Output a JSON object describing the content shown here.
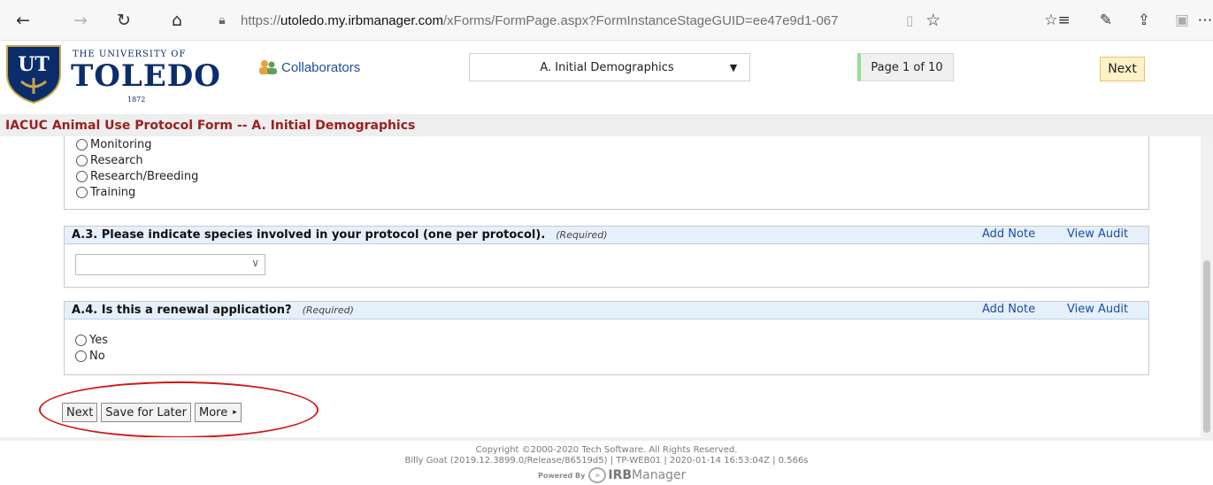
{
  "browser": {
    "url_prefix": "https://",
    "url_host": "utoledo.my.irbmanager.com",
    "url_path": "/xForms/FormPage.aspx?FormInstanceStageGUID=ee47e9d1-067",
    "icons": [
      "back-icon",
      "forward-icon",
      "refresh-icon",
      "home-icon",
      "lock-icon",
      "reading-view-icon",
      "favorite-star-icon",
      "favorites-list-icon",
      "pen-icon",
      "share-icon",
      "extension-icon",
      "more-icon"
    ]
  },
  "header": {
    "logo_university_of": "THE UNIVERSITY OF",
    "logo_name": "TOLEDO",
    "logo_year": "1872",
    "logo_monogram": "UT",
    "collaborators_label": "Collaborators",
    "section_select_value": "A. Initial Demographics",
    "page_indicator": "Page 1 of 10",
    "next_label": "Next"
  },
  "form_title": "IACUC Animal Use Protocol Form -- A. Initial Demographics",
  "previous_question_options": [
    "Monitoring",
    "Research",
    "Research/Breeding",
    "Training"
  ],
  "questions": [
    {
      "text": "A.3. Please indicate species involved in your protocol (one per protocol).",
      "required_label": "(Required)",
      "add_note": "Add Note",
      "view_audit": "View Audit",
      "select_value": ""
    },
    {
      "text": "A.4. Is this a renewal application?",
      "required_label": "(Required)",
      "add_note": "Add Note",
      "view_audit": "View Audit",
      "options": [
        "Yes",
        "No"
      ]
    }
  ],
  "footer_buttons": {
    "next": "Next",
    "save_for_later": "Save for Later",
    "more": "More"
  },
  "footer": {
    "copyright": "Copyright ©2000-2020 Tech Software. All Rights Reserved.",
    "build": "Billy Goat (2019.12.3899.0/Release/86519d5) | TP-WEB01 | 2020-01-14 16:53:04Z | 0.566s",
    "powered_by": "Powered By",
    "brand_irb": "IRB",
    "brand_manager": "Manager"
  },
  "colors": {
    "title_red": "#9b2020",
    "link_blue": "#1a4f9c",
    "question_header_bg": "#e6f0fb",
    "annotation_red": "#d01818",
    "next_highlight": "#fff2c6"
  }
}
